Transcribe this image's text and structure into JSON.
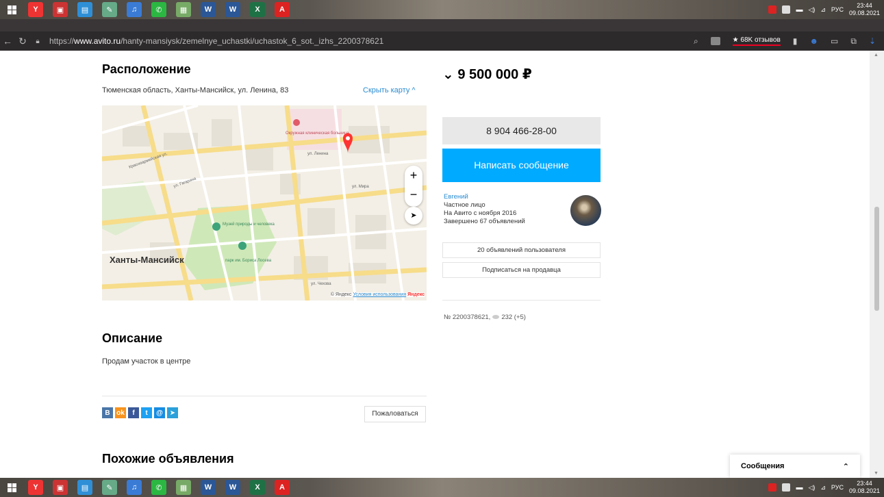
{
  "taskbar": {
    "apps": [
      {
        "name": "yandex-browser-icon",
        "color": "#e33",
        "glyph": "Y"
      },
      {
        "name": "red-app-icon",
        "color": "#c33",
        "glyph": "▣"
      },
      {
        "name": "folder-icon",
        "color": "#2e8fd6",
        "glyph": "▤"
      },
      {
        "name": "app-icon-4",
        "color": "#6a8",
        "glyph": "✎"
      },
      {
        "name": "app-icon-5",
        "color": "#3a7bd5",
        "glyph": "♫"
      },
      {
        "name": "whatsapp-icon",
        "color": "#2bb742",
        "glyph": "✆"
      },
      {
        "name": "app-icon-7",
        "color": "#7a6",
        "glyph": "▦"
      },
      {
        "name": "word-icon",
        "color": "#2b5797",
        "glyph": "W"
      },
      {
        "name": "word-doc-icon",
        "color": "#2b5797",
        "glyph": "W"
      },
      {
        "name": "excel-icon",
        "color": "#1e7145",
        "glyph": "X"
      },
      {
        "name": "acrobat-icon",
        "color": "#d22",
        "glyph": "A"
      }
    ],
    "lang": "РУС",
    "time": "23:44",
    "date": "09.08.2021"
  },
  "browser": {
    "url_prefix": "https://",
    "url_host": "www.avito.ru",
    "url_path": "/hanty-mansiysk/zemelnye_uchastki/uchastok_6_sot._izhs_2200378621",
    "reviews_badge": "★ 68K отзывов"
  },
  "location": {
    "title": "Расположение",
    "address": "Тюменская область, Ханты-Мансийск, ул. Ленина, 83",
    "hide_map": "Скрыть карту ^"
  },
  "map": {
    "city_label": "Ханты-Мансийск",
    "footer_prefix": "© Яндекс",
    "terms": "Условия использования",
    "brand": "Яндекс",
    "streets": [
      "ул. Ленина",
      "ул. Мира",
      "ул. Чехова",
      "Красноармейская ул.",
      "ул. Гагарина"
    ],
    "pois": [
      "Музей природы и человека",
      "парк им. Бориса Лосева",
      "Окружная клиническая больница"
    ]
  },
  "listing": {
    "price": "⌄ 9 500 000 ₽",
    "phone": "8 904 466-28-00",
    "message_button": "Написать сообщение"
  },
  "seller": {
    "name": "Евгений",
    "type": "Частное лицо",
    "since": "На Авито с ноября 2016",
    "completed": "Завершено 67 объявлений",
    "listings_button": "20 объявлений пользователя",
    "subscribe_button": "Подписаться на продавца"
  },
  "ad": {
    "id": "№ 2200378621,",
    "views": "232 (+5)"
  },
  "description": {
    "title": "Описание",
    "text": "Продам участок в центре"
  },
  "share": {
    "networks": [
      {
        "name": "vk-icon",
        "color": "#4a76a8",
        "glyph": "В"
      },
      {
        "name": "odnoklassniki-icon",
        "color": "#f7931e",
        "glyph": "ok"
      },
      {
        "name": "facebook-icon",
        "color": "#3b5998",
        "glyph": "f"
      },
      {
        "name": "twitter-icon",
        "color": "#1da1f2",
        "glyph": "t"
      },
      {
        "name": "mailru-icon",
        "color": "#168de2",
        "glyph": "@"
      },
      {
        "name": "telegram-icon",
        "color": "#2ba0da",
        "glyph": "➤"
      }
    ],
    "report_button": "Пожаловаться"
  },
  "similar": {
    "title": "Похожие объявления"
  },
  "messages": {
    "label": "Сообщения"
  }
}
